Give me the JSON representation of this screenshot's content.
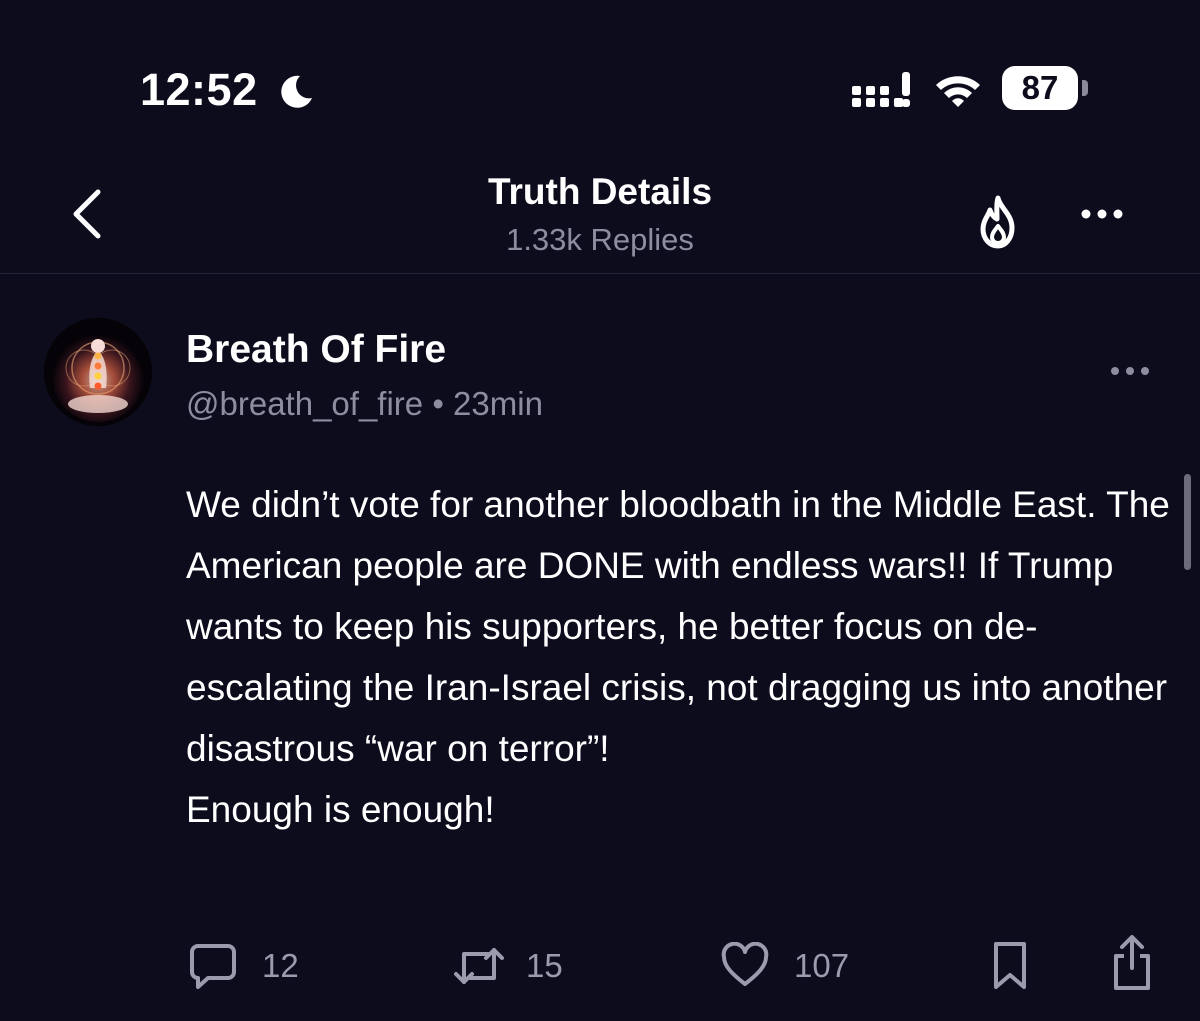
{
  "status_bar": {
    "time": "12:52",
    "battery": "87",
    "icons": [
      "moon-icon",
      "signal-icon",
      "wifi-icon",
      "battery-icon"
    ]
  },
  "header": {
    "title": "Truth Details",
    "subtitle": "1.33k Replies",
    "icons": [
      "chevron-left-icon",
      "fire-icon",
      "more-horizontal-icon"
    ]
  },
  "post": {
    "author_name": "Breath Of Fire",
    "handle": "@breath_of_fire",
    "separator": "•",
    "time_ago": "23min",
    "body_lines": [
      "We didn’t vote for another bloodbath in the Middle East. The American people are DONE with endless wars!! If Trump wants to keep his supporters, he better focus on de-escalating the Iran-Israel crisis, not dragging us into another disastrous “war on terror”!",
      "Enough is enough!"
    ],
    "actions": {
      "replies": "12",
      "retruths": "15",
      "likes": "107"
    },
    "action_icons": [
      "reply-icon",
      "retruth-icon",
      "heart-icon",
      "bookmark-icon",
      "share-icon"
    ]
  },
  "colors": {
    "background": "#0d0c1d",
    "text_primary": "#ffffff",
    "text_secondary": "#8e8da0",
    "divider": "#24233a"
  }
}
